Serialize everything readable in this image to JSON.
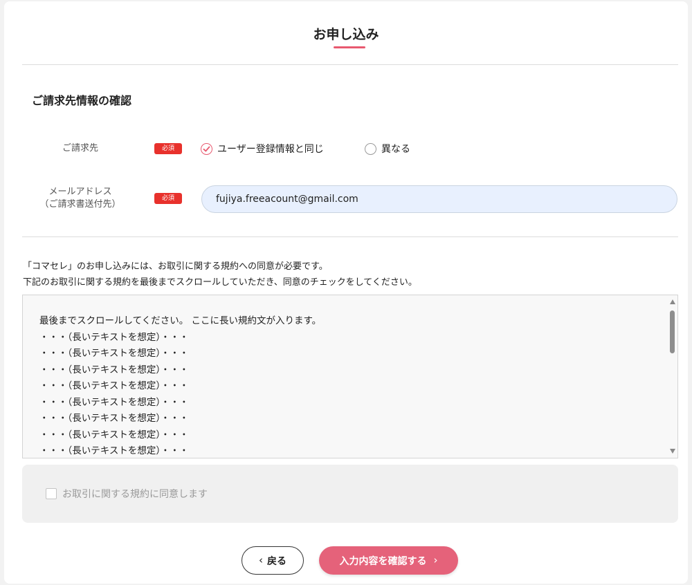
{
  "header": {
    "title": "お申し込み",
    "accent_color": "#e8596f"
  },
  "billing_section": {
    "title": "ご請求先情報の確認",
    "billing_field": {
      "label": "ご請求先",
      "required_badge": "必須",
      "options": [
        {
          "label": "ユーザー登録情報と同じ",
          "selected": true
        },
        {
          "label": "異なる",
          "selected": false
        }
      ]
    },
    "email_field": {
      "label_line1": "メールアドレス",
      "label_line2": "（ご請求書送付先）",
      "required_badge": "必須",
      "value": "fujiya.freeacount@gmail.com"
    }
  },
  "terms": {
    "notice_line1": "「コマセレ」のお申し込みには、お取引に関する規約への同意が必要です。",
    "notice_line2": "下記のお取引に関する規約を最後までスクロールしていただき、同意のチェックをしてください。",
    "lines": [
      "最後までスクロールしてください。 ここに長い規約文が入ります。",
      "・・・（長いテキストを想定）・・・",
      "・・・（長いテキストを想定）・・・",
      "・・・（長いテキストを想定）・・・",
      "・・・（長いテキストを想定）・・・",
      "・・・（長いテキストを想定）・・・",
      "・・・（長いテキストを想定）・・・",
      "・・・（長いテキストを想定）・・・",
      "・・・（長いテキストを想定）・・・"
    ],
    "agree_label": "お取引に関する規約に同意します",
    "agree_checked": false
  },
  "actions": {
    "back_label": "戻る",
    "confirm_label": "入力内容を確認する",
    "confirm_color": "#e5627a",
    "required_color": "#e8312c"
  }
}
